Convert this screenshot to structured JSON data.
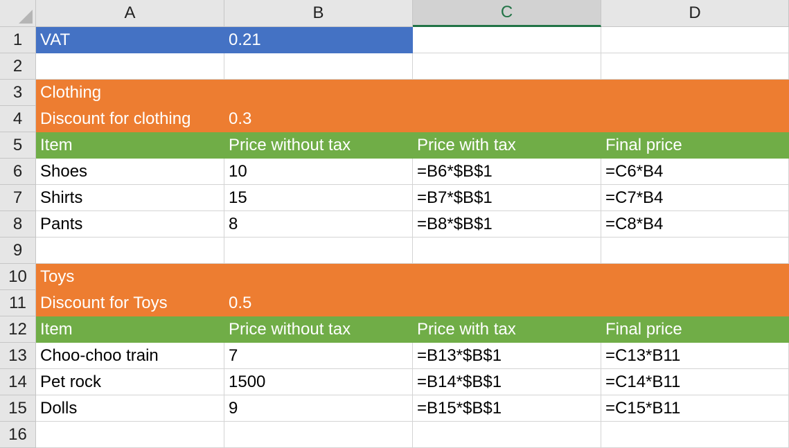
{
  "columns": [
    "A",
    "B",
    "C",
    "D"
  ],
  "selected_column": "C",
  "rows": [
    "1",
    "2",
    "3",
    "4",
    "5",
    "6",
    "7",
    "8",
    "9",
    "10",
    "11",
    "12",
    "13",
    "14",
    "15",
    "16"
  ],
  "cells": {
    "A1": "VAT",
    "B1": "0.21",
    "A3": "Clothing",
    "A4": "Discount for clothing",
    "B4": "0.3",
    "A5": "Item",
    "B5": "Price without tax",
    "C5": "Price with tax",
    "D5": "Final price",
    "A6": "Shoes",
    "B6": "10",
    "C6": "=B6*$B$1",
    "D6": "=C6*B4",
    "A7": "Shirts",
    "B7": "15",
    "C7": "=B7*$B$1",
    "D7": "=C7*B4",
    "A8": "Pants",
    "B8": "8",
    "C8": "=B8*$B$1",
    "D8": "=C8*B4",
    "A10": "Toys",
    "A11": "Discount for Toys",
    "B11": "0.5",
    "A12": "Item",
    "B12": "Price without tax",
    "C12": "Price with tax",
    "D12": "Final price",
    "A13": "Choo-choo train",
    "B13": "7",
    "C13": "=B13*$B$1",
    "D13": "=C13*B11",
    "A14": "Pet rock",
    "B14": "1500",
    "C14": "=B14*$B$1",
    "D14": "=C14*B11",
    "A15": "Dolls",
    "B15": "9",
    "C15": "=B15*$B$1",
    "D15": "=C15*B11"
  },
  "fills": {
    "A1": "#4472c4",
    "B1": "#4472c4",
    "row3": "#ed7d31",
    "row4": "#ed7d31",
    "row10": "#ed7d31",
    "row11": "#ed7d31",
    "row5": "#70ad47",
    "row12": "#70ad47"
  }
}
